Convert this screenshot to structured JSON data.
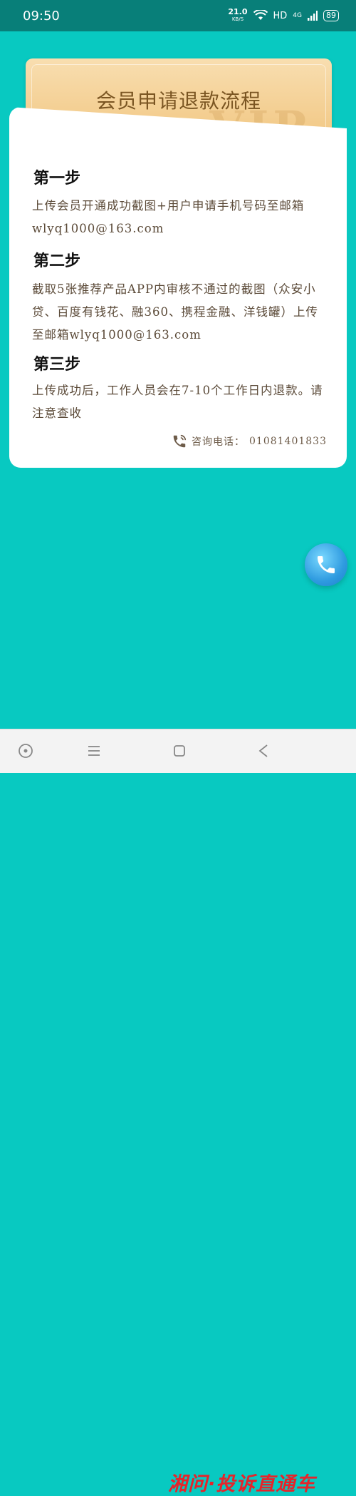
{
  "status_bar": {
    "time": "09:50",
    "net_speed": "21.0",
    "net_unit": "KB/S",
    "hd": "HD",
    "signal": "4G",
    "battery": "89"
  },
  "header": {
    "title": "会员申请退款流程",
    "badge": "VIP"
  },
  "steps": [
    {
      "title": "第一步",
      "text": "上传会员开通成功截图+用户申请手机号码至邮箱wlyq1000@163.com"
    },
    {
      "title": "第二步",
      "text": "截取5张推荐产品APP内审核不通过的截图（众安小贷、百度有钱花、融360、携程金融、洋钱罐）上传至邮箱wlyq1000@163.com"
    },
    {
      "title": "第三步",
      "text": "上传成功后，工作人员会在7-10个工作日内退款。请注意查收"
    }
  ],
  "consult": {
    "label": "咨询电话：",
    "phone": "01081401833"
  },
  "watermark": "湘问·投诉直通车",
  "colors": {
    "background": "#08c9c1",
    "status_bar": "#087f79",
    "ticket": "#f1c57f"
  }
}
